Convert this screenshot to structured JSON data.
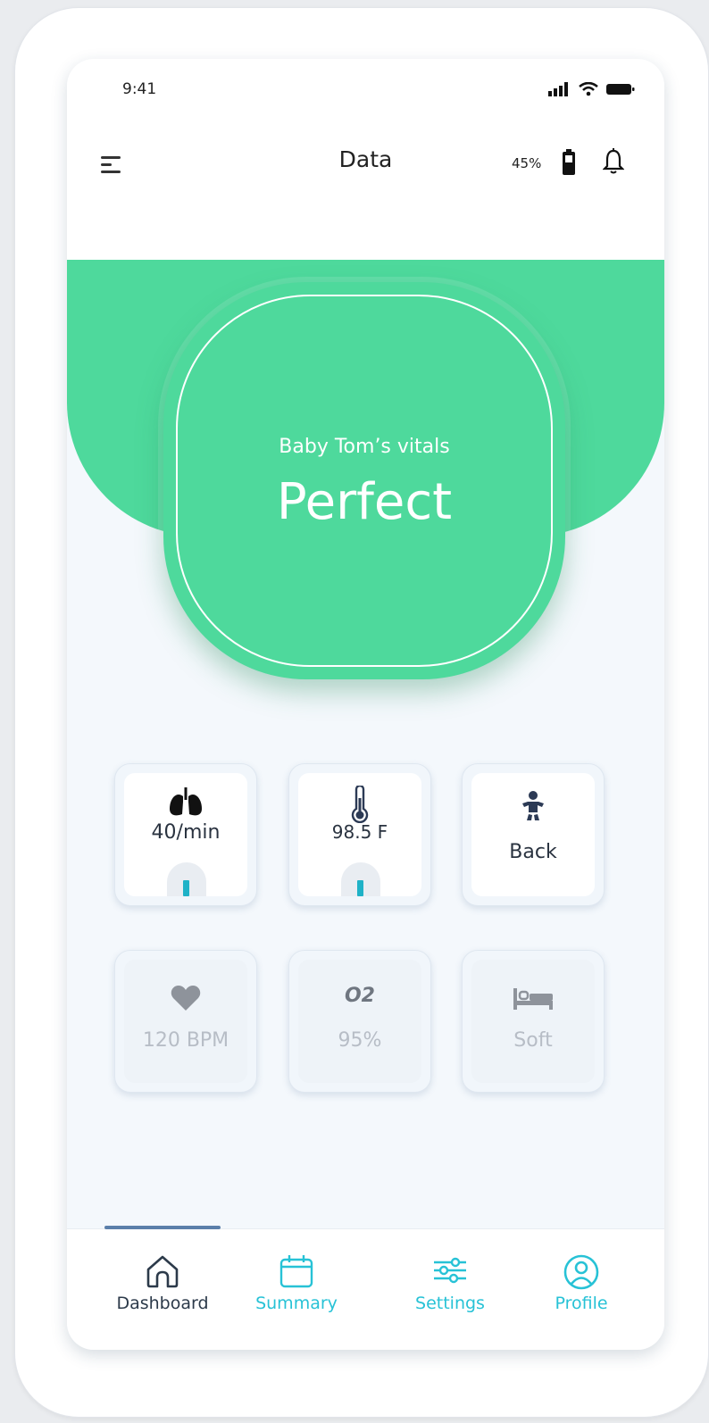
{
  "status_bar": {
    "time": "9:41"
  },
  "header": {
    "title": "Data",
    "battery_percent": "45%"
  },
  "vitals": {
    "subtitle": "Baby Tom’s vitals",
    "status": "Perfect"
  },
  "tiles": [
    {
      "icon": "lungs-icon",
      "label": "40/min",
      "active": true,
      "gauge_level": 0.4
    },
    {
      "icon": "thermometer-icon",
      "label": "98.5 F",
      "active": true,
      "gauge_level": 0.4
    },
    {
      "icon": "baby-icon",
      "label": "Back",
      "active": true
    },
    {
      "icon": "heart-icon",
      "label": "120 BPM",
      "active": false
    },
    {
      "icon": "o2-icon",
      "icon_text": "O2",
      "label": "95%",
      "active": false
    },
    {
      "icon": "bed-icon",
      "label": "Soft",
      "active": false
    }
  ],
  "nav": [
    {
      "icon": "home-icon",
      "label": "Dashboard",
      "active": true
    },
    {
      "icon": "calendar-icon",
      "label": "Summary",
      "active": false
    },
    {
      "icon": "sliders-icon",
      "label": "Settings",
      "active": false
    },
    {
      "icon": "profile-icon",
      "label": "Profile",
      "active": false
    }
  ],
  "colors": {
    "brand_green": "#4ed99c",
    "accent_teal": "#27c2d6",
    "nav_indicator": "#5b7faa",
    "text_dark": "#2a3340",
    "text_dim": "#b7bdc6"
  }
}
